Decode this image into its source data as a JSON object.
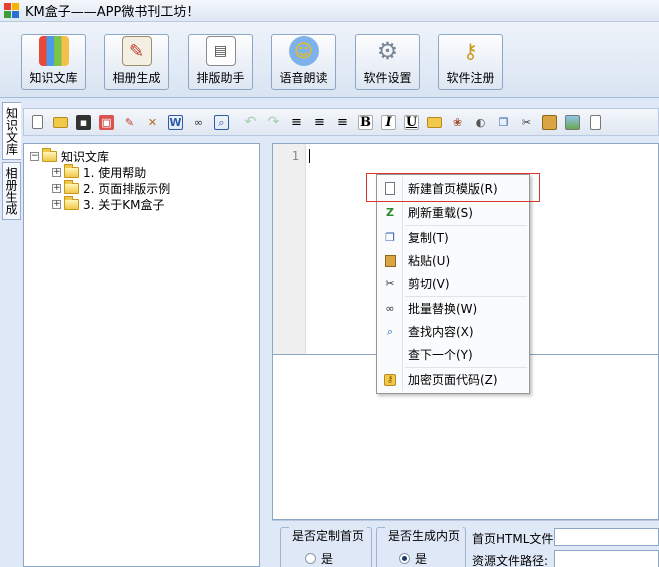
{
  "window": {
    "title": "KM盒子——APP微书刊工坊！"
  },
  "big_toolbar": [
    {
      "label": "知识文库",
      "icon": "books-icon"
    },
    {
      "label": "相册生成",
      "icon": "paint-icon"
    },
    {
      "label": "排版助手",
      "icon": "calendar-icon"
    },
    {
      "label": "语音朗读",
      "icon": "chat-icon"
    },
    {
      "label": "软件设置",
      "icon": "gear-icon"
    },
    {
      "label": "软件注册",
      "icon": "key-icon"
    }
  ],
  "side_tabs": [
    "知识文库",
    "相册生成"
  ],
  "tree": {
    "root": "知识文库",
    "children": [
      "1. 使用帮助",
      "2. 页面排版示例",
      "3. 关于KM盒子"
    ]
  },
  "editor": {
    "line_number": "1"
  },
  "context_menu": [
    {
      "label": "新建首页模版(R)",
      "icon": "new-page-icon"
    },
    {
      "label": "刷新重载(S)",
      "icon": "refresh-icon"
    },
    {
      "label": "复制(T)",
      "icon": "copy-icon"
    },
    {
      "label": "粘贴(U)",
      "icon": "paste-icon"
    },
    {
      "label": "剪切(V)",
      "icon": "cut-icon"
    },
    {
      "label": "批量替换(W)",
      "icon": "binoculars-icon"
    },
    {
      "label": "查找内容(X)",
      "icon": "find-icon"
    },
    {
      "label": "查下一个(Y)",
      "icon": ""
    },
    {
      "label": "加密页面代码(Z)",
      "icon": "lock-key-icon"
    }
  ],
  "bottom": {
    "custom_home_legend": "是否定制首页",
    "custom_home_option": "是",
    "gen_inner_legend": "是否生成内页",
    "gen_inner_option": "是",
    "home_html_label": "首页HTML文件:",
    "resource_path_label": "资源文件路径:"
  },
  "colors": {
    "highlight": "#d9362e",
    "chrome": "#dfe8f6"
  }
}
